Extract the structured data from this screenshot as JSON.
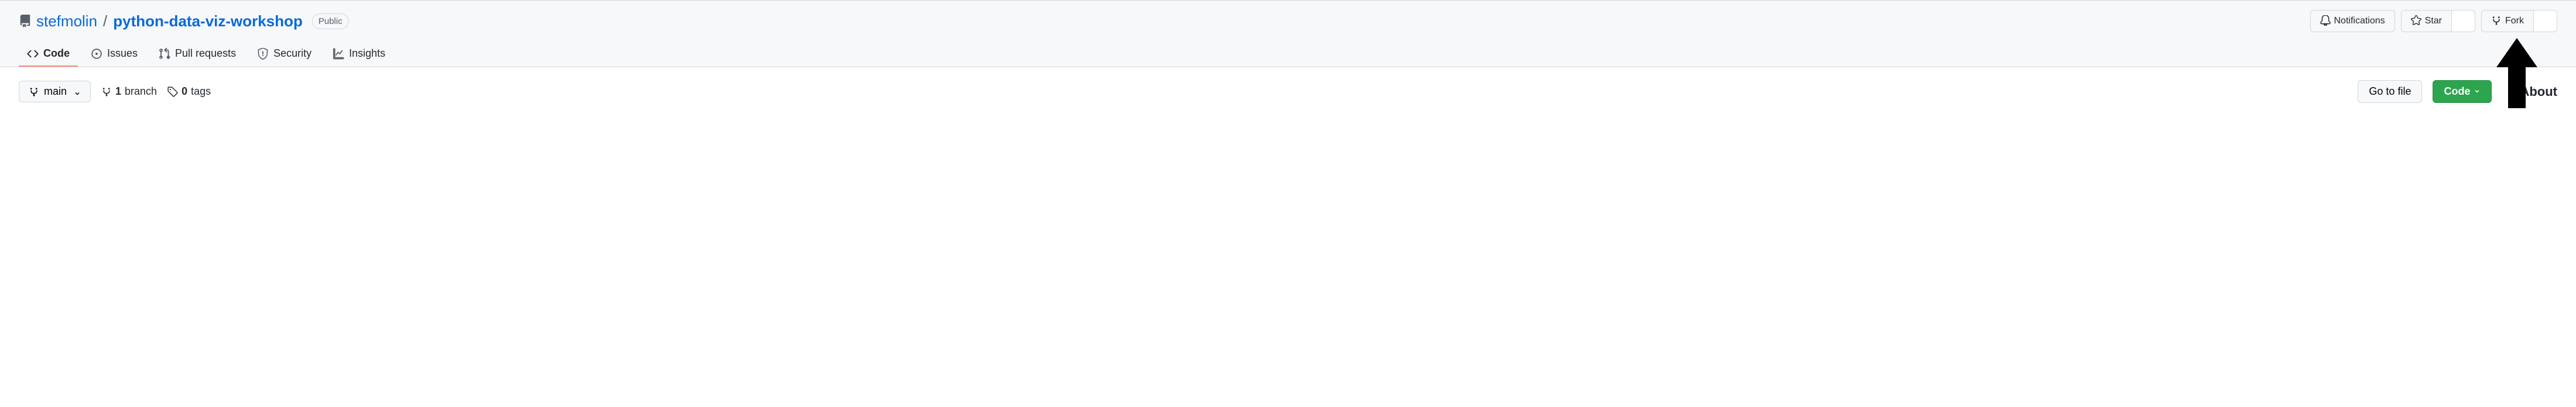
{
  "repo": {
    "owner": "stefmolin",
    "name": "python-data-viz-workshop",
    "visibility": "Public"
  },
  "actions": {
    "notifications": "Notifications",
    "star": "Star",
    "starCount": "",
    "fork": "Fork",
    "forkCount": ""
  },
  "tabs": {
    "code": "Code",
    "issues": "Issues",
    "pulls": "Pull requests",
    "security": "Security",
    "insights": "Insights"
  },
  "branch": {
    "default": "main",
    "branchCount": "1",
    "branchLabel": "branch",
    "tagCount": "0",
    "tagLabel": "tags"
  },
  "fileActions": {
    "goToFile": "Go to file",
    "code": "Code"
  },
  "sidebar": {
    "about": "About"
  }
}
